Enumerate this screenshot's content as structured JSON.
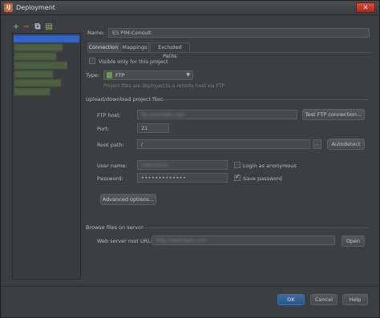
{
  "window": {
    "title": "Deployment",
    "app_icon": "ij-app-icon"
  },
  "toolbar": [
    {
      "name": "add-server-icon",
      "glyph": "+",
      "color": "#5fb85c"
    },
    {
      "name": "remove-server-icon",
      "glyph": "−",
      "color": "#d9534f"
    },
    {
      "name": "copy-server-icon",
      "glyph": "⧉",
      "color": "#b8c0c8"
    },
    {
      "name": "default-server-icon",
      "glyph": "▤",
      "color": "#8fbf68"
    }
  ],
  "server": {
    "name_label": "Name:",
    "name_value": "ES PIM-Consult",
    "tabs": [
      "Connection",
      "Mappings",
      "Excluded Paths"
    ],
    "visible_label": "Visible only for this project",
    "type_label": "Type:",
    "type_value": "FTP",
    "type_hint": "Project files are deployed to a remote host via FTP",
    "section_upload": "Upload/download project files",
    "ftp_host_label": "FTP host:",
    "ftp_host_value": "ftp.example.com",
    "test_button": "Test FTP connection...",
    "port_label": "Port:",
    "port_value": "21",
    "root_path_label": "Root path:",
    "root_path_value": "/",
    "browse_button": "...",
    "autodetect_button": "Autodetect",
    "user_label": "User name:",
    "user_value": "username",
    "password_label": "Password:",
    "password_value": "•••••••••••••",
    "anonymous_label": "Login as anonymous",
    "save_password_label": "Save password",
    "advanced_button": "Advanced options...",
    "section_browse": "Browse files on server",
    "web_root_label": "Web server root URL:",
    "web_root_value": "http://example.com",
    "open_button": "Open"
  },
  "footer": {
    "ok": "OK",
    "cancel": "Cancel",
    "help": "Help"
  },
  "check": {
    "save_password": "✓",
    "close_glyph": "✕",
    "combo_arrow": "▼"
  }
}
